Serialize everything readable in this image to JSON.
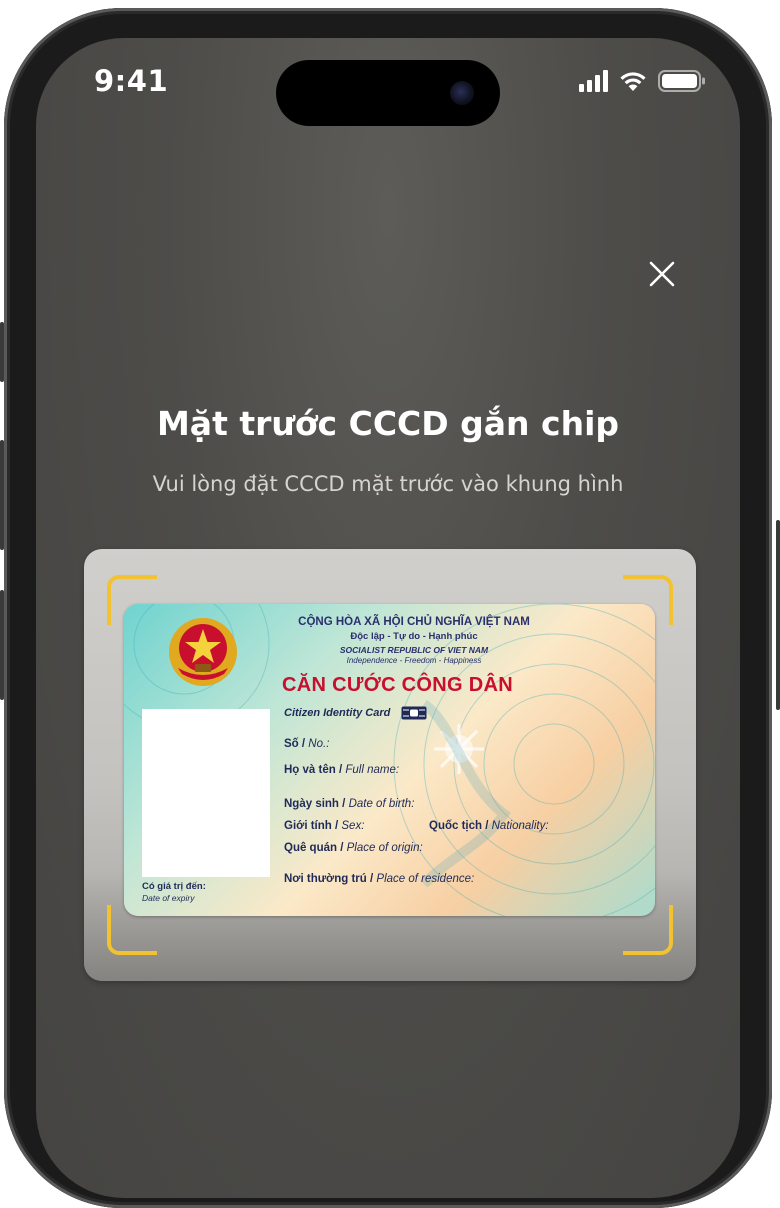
{
  "status_bar": {
    "time": "9:41",
    "icons": [
      "signal-icon",
      "wifi-icon",
      "battery-icon"
    ]
  },
  "close_icon": "close-icon",
  "screen": {
    "title": "Mặt trước CCCD gắn chip",
    "subtitle": "Vui lòng đặt CCCD mặt trước vào khung hình"
  },
  "id_card": {
    "line1": "CỘNG HÒA XÃ HỘI CHỦ NGHĨA VIỆT NAM",
    "line2": "Độc lập - Tự do - Hạnh phúc",
    "line3": "SOCIALIST REPUBLIC OF VIET NAM",
    "line4": "Independence - Freedom - Happiness",
    "card_title": "CĂN CƯỚC CÔNG DÂN",
    "card_subtitle": "Citizen Identity Card",
    "fields": {
      "number_vi": "Số",
      "number_en": "No.:",
      "name_vi": "Họ và tên",
      "name_en": "Full name:",
      "dob_vi": "Ngày sinh",
      "dob_en": "Date of birth:",
      "sex_vi": "Giới tính",
      "sex_en": "Sex:",
      "nationality_vi": "Quốc tịch",
      "nationality_en": "Nationality:",
      "origin_vi": "Quê quán",
      "origin_en": "Place of origin:",
      "residence_vi": "Nơi thường trú",
      "residence_en": "Place of residence:",
      "expiry_vi": "Có giá trị đến:",
      "expiry_en": "Date of expiry"
    }
  },
  "colors": {
    "accent_bracket": "#f2c230",
    "card_title_red": "#c8102e",
    "text_navy": "#2a2f6e"
  }
}
